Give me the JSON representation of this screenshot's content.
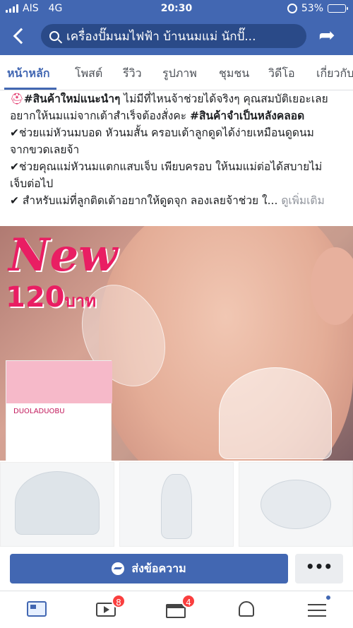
{
  "status_bar": {
    "carrier": "AIS",
    "network": "4G",
    "time": "20:30",
    "battery": "53%",
    "battery_level": 0.53
  },
  "header": {
    "search_text": "เครื่องปั๊มนมไฟฟ้า บ้านนมแม่ นักปั๊...",
    "icons": [
      "back-icon",
      "search-icon",
      "share-icon"
    ]
  },
  "tabs": [
    {
      "label": "หน้าหลัก",
      "active": true
    },
    {
      "label": "โพสต์"
    },
    {
      "label": "รีวิว"
    },
    {
      "label": "รูปภาพ"
    },
    {
      "label": "ชุมชน"
    },
    {
      "label": "วิดีโอ"
    },
    {
      "label": "เกี่ยวกับ"
    }
  ],
  "post": {
    "line1_bold": "#สินค้าใหม่แนะนำๆ",
    "line1_rest": " ไม่มีที่ไหนจ้าช่วยได้จริงๆ คุณสมบัติเยอะเลย",
    "line2_start": "อยากให้นมแม่จากเต้าสำเร็จต้องสั่งคะ ",
    "line2_bold": "#สินค้าจำเป็นหลังคลอด",
    "line3": "✔ช่วยแม่หัวนมบอด หัวนมสั้น ครอบเต้าลูกดูดได้ง่ายเหมือนดูดนม",
    "line4": "จากขวดเลยจ้า",
    "line5": "✔ช่วยคุณแม่หัวนมแตกแสบเจ็บ เพียบครอบ ให้นมแม่ต่อได้สบายไม่",
    "line6": "เจ็บต่อไป",
    "line7": "✔ สำหรับแม่ที่ลูกติดเต้าอยากให้ดูดจุก ลองเลยจ้าช่วย ใ... ",
    "see_more": "ดูเพิ่มเติม"
  },
  "photo": {
    "new_label": "New",
    "price_number": "120",
    "price_unit": "บาท",
    "box_brand": "DUOLADUOBU"
  },
  "actions": {
    "message_label": "ส่งข้อความ",
    "more_label": "•••"
  },
  "bottom_nav": {
    "watch_badge": "8",
    "marketplace_badge": "4"
  }
}
